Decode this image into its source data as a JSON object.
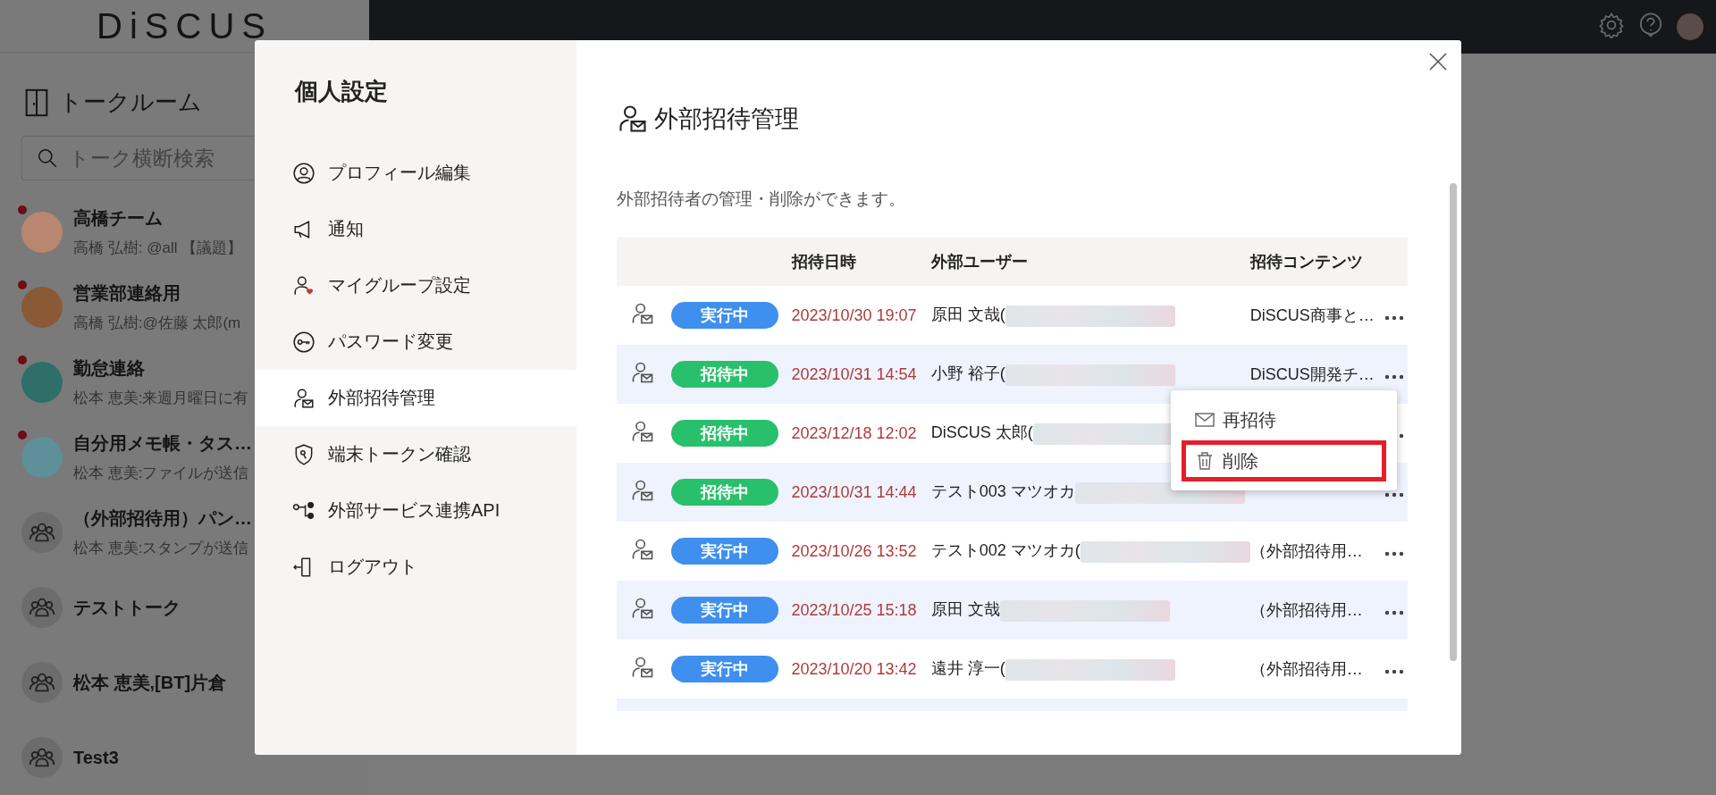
{
  "app": {
    "logo": "DiSCUS"
  },
  "sidebar": {
    "title": "トークルーム",
    "search": {
      "placeholder": "トーク横断検索"
    },
    "items": [
      {
        "name": "高橋チーム",
        "preview": "高橋 弘樹: @all 【議題】",
        "unread": true,
        "avatar": {
          "kind": "image",
          "color": "#b9876f"
        }
      },
      {
        "name": "営業部連絡用",
        "preview": "高橋 弘樹:@佐藤 太郎(m",
        "unread": true,
        "avatar": {
          "kind": "image",
          "color": "#8a5a36"
        }
      },
      {
        "name": "勤怠連絡",
        "preview": "松本 恵美:来週月曜日に有",
        "unread": true,
        "avatar": {
          "kind": "image",
          "color": "#2f6f6a"
        }
      },
      {
        "name": "自分用メモ帳・タス…",
        "preview": "松本 恵美:ファイルが送信",
        "unread": true,
        "avatar": {
          "kind": "image",
          "color": "#5f8f98"
        }
      },
      {
        "name": "（外部招待用）パン…",
        "preview": "松本 恵美:スタンプが送信",
        "unread": false,
        "avatar": {
          "kind": "group"
        }
      },
      {
        "name": "テストトーク",
        "unread": false,
        "avatar": {
          "kind": "group"
        }
      },
      {
        "name": "松本 恵美,[BT]片倉",
        "unread": false,
        "avatar": {
          "kind": "group"
        }
      },
      {
        "name": "Test3",
        "unread": false,
        "avatar": {
          "kind": "group"
        }
      }
    ]
  },
  "modal": {
    "title": "個人設定",
    "menu": [
      {
        "label": "プロフィール編集",
        "selected": false
      },
      {
        "label": "通知",
        "selected": false
      },
      {
        "label": "マイグループ設定",
        "selected": false
      },
      {
        "label": "パスワード変更",
        "selected": false
      },
      {
        "label": "外部招待管理",
        "selected": true
      },
      {
        "label": "端末トークン確認",
        "selected": false
      },
      {
        "label": "外部サービス連携API",
        "selected": false
      },
      {
        "label": "ログアウト",
        "selected": false
      }
    ],
    "page_title": "外部招待管理",
    "description": "外部招待者の管理・削除ができます。",
    "table": {
      "columns": [
        "招待日時",
        "外部ユーザー",
        "招待コンテンツ"
      ],
      "rows": [
        {
          "status": {
            "label": "実行中",
            "kind": "running"
          },
          "date": "2023/10/30 19:07",
          "user": "原田 文哉(",
          "content": "DiSCUS商事と…"
        },
        {
          "status": {
            "label": "招待中",
            "kind": "inviting"
          },
          "date": "2023/10/31 14:54",
          "user": "小野 裕子(",
          "content": "DiSCUS開発チ…"
        },
        {
          "status": {
            "label": "招待中",
            "kind": "inviting"
          },
          "date": "2023/12/18 12:02",
          "user": "DiSCUS 太郎("
        },
        {
          "status": {
            "label": "招待中",
            "kind": "inviting"
          },
          "date": "2023/10/31 14:44",
          "user": "テスト003 マツオカ"
        },
        {
          "status": {
            "label": "実行中",
            "kind": "running"
          },
          "date": "2023/10/26 13:52",
          "user": "テスト002 マツオカ(",
          "content": "（外部招待用…"
        },
        {
          "status": {
            "label": "実行中",
            "kind": "running"
          },
          "date": "2023/10/25 15:18",
          "user": "原田 文哉",
          "content": "（外部招待用…"
        },
        {
          "status": {
            "label": "実行中",
            "kind": "running"
          },
          "date": "2023/10/20 13:42",
          "user": "遠井 淳一(",
          "content": "（外部招待用…"
        }
      ]
    },
    "context_menu": [
      {
        "label": "再招待",
        "highlighted": false
      },
      {
        "label": "削除",
        "highlighted": true
      }
    ]
  }
}
